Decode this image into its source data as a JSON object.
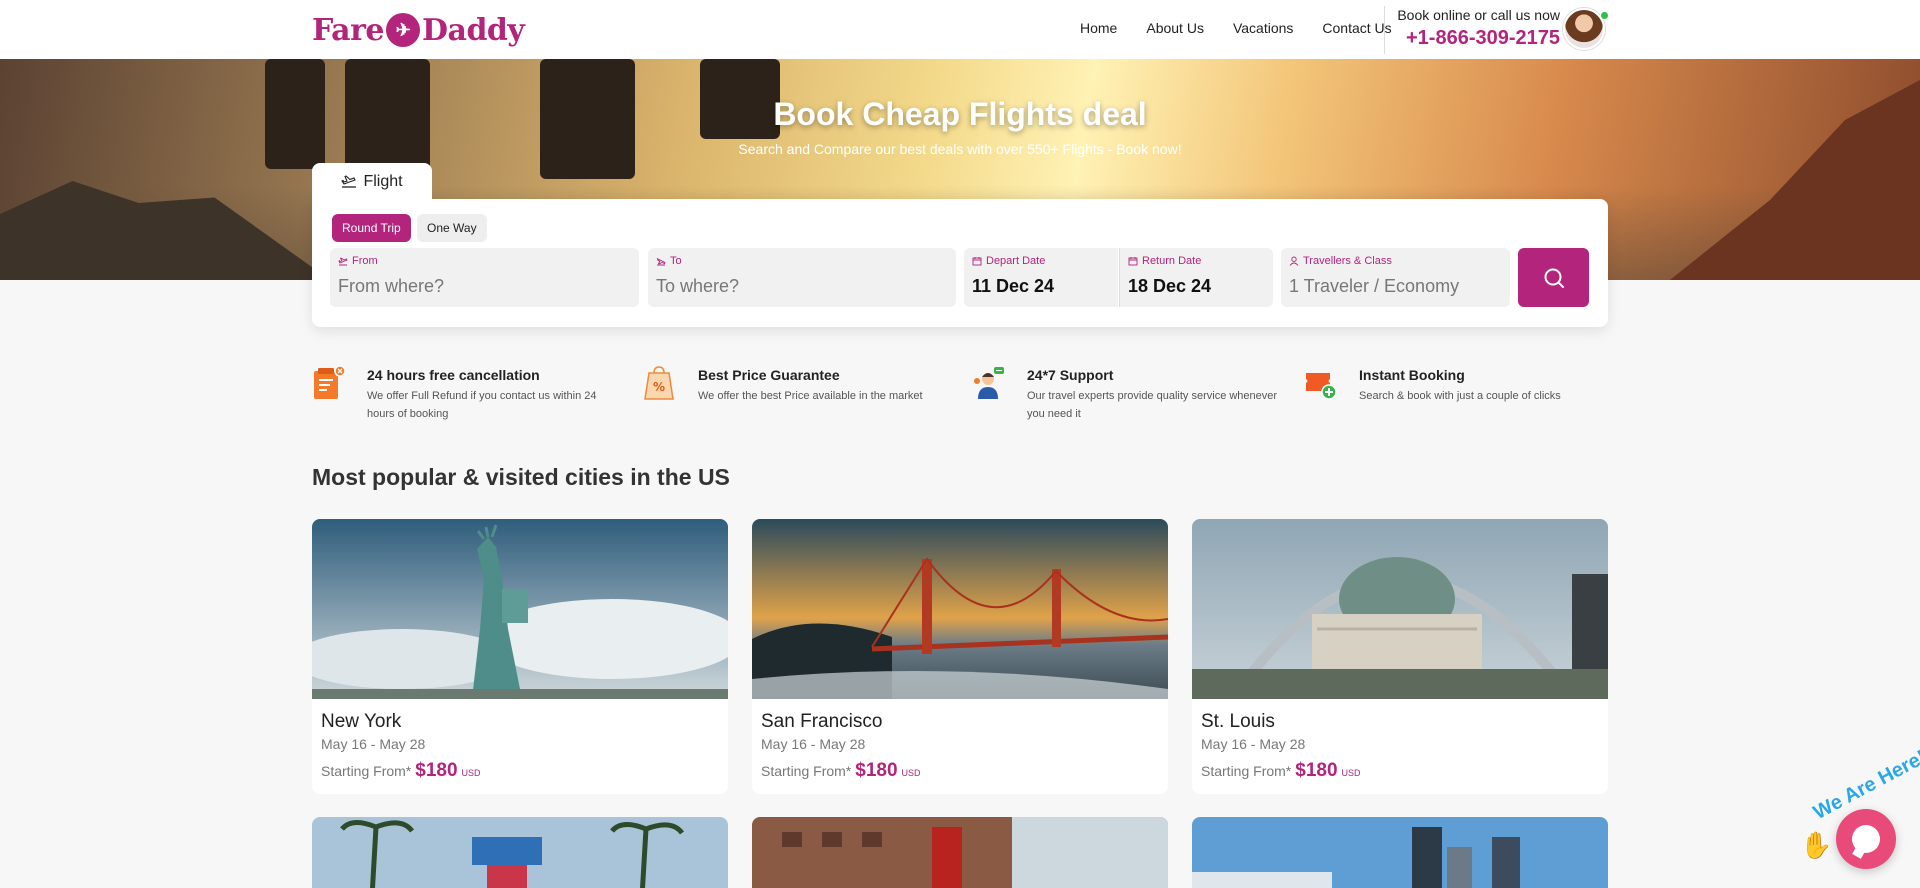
{
  "header": {
    "logo_text_left": "Fare",
    "logo_text_right": "Daddy",
    "nav": [
      "Home",
      "About Us",
      "Vacations",
      "Contact Us"
    ],
    "callout_text": "Book online or call us now",
    "phone": "+1-866-309-2175"
  },
  "hero": {
    "title": "Book Cheap Flights deal",
    "subtitle": "Search and Compare our best deals with over 550+ Flights - Book now!"
  },
  "search": {
    "tab_label": "Flight",
    "trip_types": [
      "Round Trip",
      "One Way"
    ],
    "active_trip": "Round Trip",
    "from": {
      "label": "From",
      "placeholder": "From where?"
    },
    "to": {
      "label": "To",
      "placeholder": "To where?"
    },
    "depart": {
      "label": "Depart Date",
      "value": "11 Dec 24"
    },
    "return": {
      "label": "Return Date",
      "value": "18 Dec 24"
    },
    "travellers": {
      "label": "Travellers & Class",
      "value": "1 Traveler / Economy"
    }
  },
  "features": [
    {
      "title": "24 hours free cancellation",
      "desc": "We offer Full Refund if you contact us within 24 hours of booking",
      "icon": "cancellation-icon"
    },
    {
      "title": "Best Price Guarantee",
      "desc": "We offer the best Price available in the market",
      "icon": "price-tag-icon"
    },
    {
      "title": "24*7 Support",
      "desc": "Our travel experts provide quality service whenever you need it",
      "icon": "support-agent-icon"
    },
    {
      "title": "Instant Booking",
      "desc": "Search & book with just a couple of clicks",
      "icon": "ticket-icon"
    }
  ],
  "popular": {
    "title": "Most popular & visited cities in the US",
    "cities": [
      {
        "name": "New York",
        "dates": "May 16 - May 28",
        "from_label": "Starting From*",
        "price": "$180",
        "currency": "USD"
      },
      {
        "name": "San Francisco",
        "dates": "May 16 - May 28",
        "from_label": "Starting From*",
        "price": "$180",
        "currency": "USD"
      },
      {
        "name": "St. Louis",
        "dates": "May 16 - May 28",
        "from_label": "Starting From*",
        "price": "$180",
        "currency": "USD"
      }
    ]
  },
  "chat": {
    "badge_text": "We Are Here!"
  },
  "colors": {
    "brand": "#b3247c",
    "chat": "#e84a7a",
    "online": "#2bc24a"
  }
}
